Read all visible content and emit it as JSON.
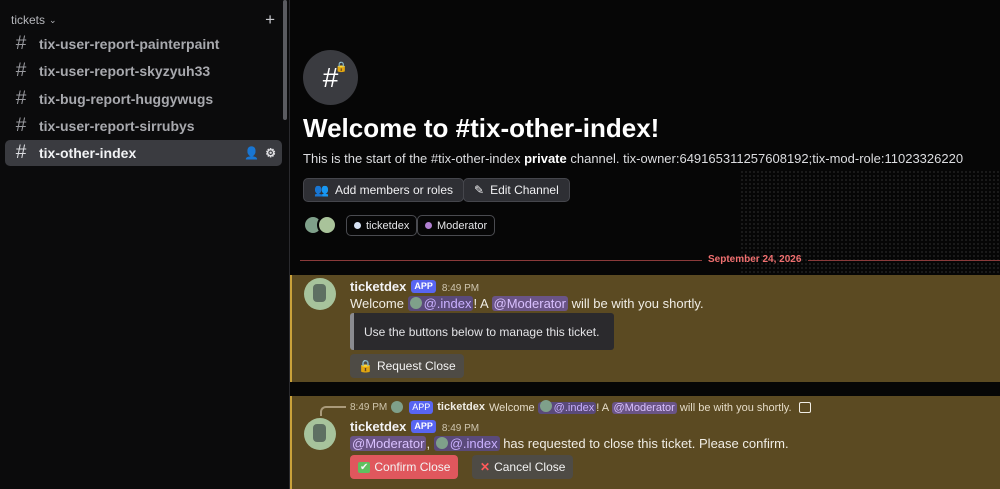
{
  "sidebar": {
    "category": "tickets",
    "channels": [
      {
        "name": "tix-user-report-painterpaint"
      },
      {
        "name": "tix-user-report-skyzyuh33"
      },
      {
        "name": "tix-bug-report-huggywugs"
      },
      {
        "name": "tix-user-report-sirrubys"
      },
      {
        "name": "tix-other-index"
      }
    ],
    "active_channel": "tix-other-index"
  },
  "welcome": {
    "title": "Welcome to #tix-other-index!",
    "desc_prefix": "This is the start of the #tix-other-index ",
    "desc_bold": "private",
    "desc_suffix": " channel. tix-owner:649165311257608192;tix-mod-role:11023326220",
    "add_members_label": "Add members or roles",
    "edit_channel_label": "Edit Channel",
    "tags": [
      {
        "label": "ticketdex",
        "color": "#d8e3f5"
      },
      {
        "label": "Moderator",
        "color": "#b07fd0"
      }
    ]
  },
  "divider": {
    "date": "September 24, 2026"
  },
  "messages": [
    {
      "author": "ticketdex",
      "badge": "APP",
      "time": "8:49 PM",
      "text_welcome": "Welcome ",
      "mention_user": "@.index",
      "text_mid": "! A ",
      "mention_role": "@Moderator",
      "text_end": " will be with you shortly.",
      "embed_text": "Use the buttons below to manage this ticket.",
      "button_label": "Request Close"
    },
    {
      "reply": {
        "time": "8:49 PM",
        "badge": "APP",
        "author": "ticketdex",
        "text_welcome": "Welcome ",
        "mention_user": "@.index",
        "text_mid": "! A ",
        "mention_role": "@Moderator",
        "text_end": " will be with you shortly."
      },
      "author": "ticketdex",
      "badge": "APP",
      "time": "8:49 PM",
      "mention_role": "@Moderator",
      "comma": ", ",
      "mention_user": "@.index",
      "text": " has requested to close this ticket. Please confirm.",
      "confirm_label": "Confirm Close",
      "cancel_label": "Cancel Close"
    }
  ],
  "colors": {
    "accent": "#5865f2",
    "highlight": "#5b4a22",
    "danger": "#e0575d"
  }
}
